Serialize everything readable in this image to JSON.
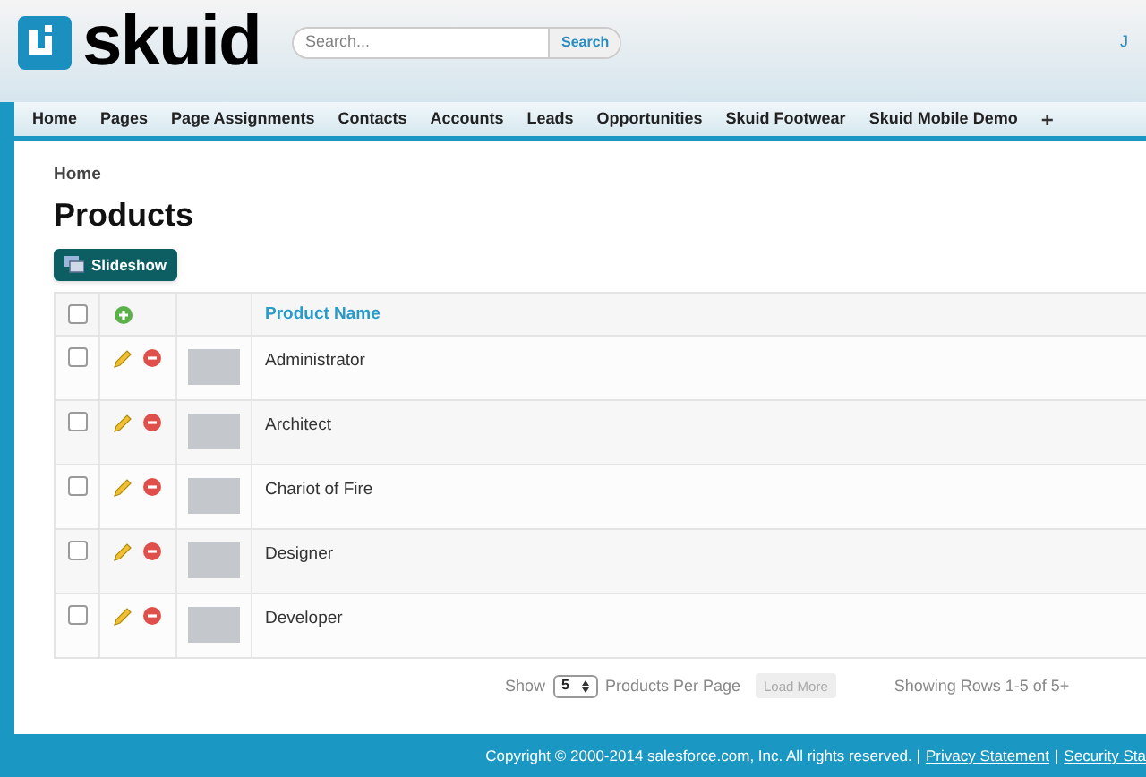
{
  "header": {
    "logo_text": "skuid",
    "search": {
      "placeholder": "Search...",
      "button": "Search"
    },
    "user_initial": "J"
  },
  "nav": {
    "tabs": [
      {
        "label": "Home",
        "selected": false
      },
      {
        "label": "Pages",
        "selected": false
      },
      {
        "label": "Page Assignments",
        "selected": false
      },
      {
        "label": "Contacts",
        "selected": false
      },
      {
        "label": "Accounts",
        "selected": false
      },
      {
        "label": "Leads",
        "selected": false
      },
      {
        "label": "Opportunities",
        "selected": false
      },
      {
        "label": "Skuid Footwear",
        "selected": false
      },
      {
        "label": "Skuid Mobile Demo",
        "selected": false
      }
    ],
    "add_tab": "+"
  },
  "breadcrumb": "Home",
  "title": "Products",
  "slideshow_button": "Slideshow",
  "table": {
    "select_all_checked": false,
    "columns": [
      "Product Name"
    ],
    "rows": [
      {
        "name": "Administrator",
        "checked": false
      },
      {
        "name": "Architect",
        "checked": false
      },
      {
        "name": "Chariot of Fire",
        "checked": false
      },
      {
        "name": "Designer",
        "checked": false
      },
      {
        "name": "Developer",
        "checked": false
      }
    ]
  },
  "pager": {
    "show_label": "Show",
    "per_page": "5",
    "per_page_label": "Products Per Page",
    "load_more": "Load More",
    "load_more_disabled": true,
    "rows_info": "Showing Rows 1-5 of 5+"
  },
  "footer": {
    "copyright": "Copyright © 2000-2014 salesforce.com, Inc. All rights reserved. |",
    "links": [
      "Privacy Statement",
      "Security Sta"
    ],
    "separator": "|"
  }
}
